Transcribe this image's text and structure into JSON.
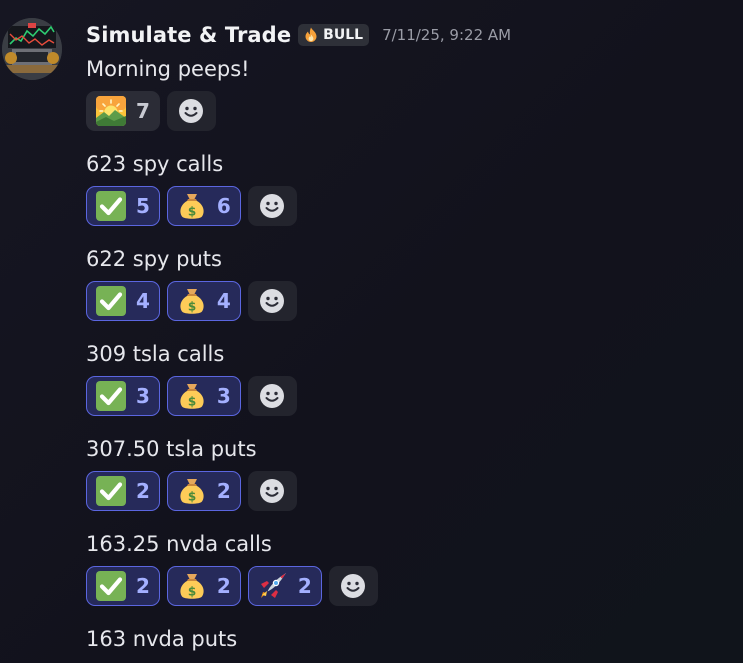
{
  "message": {
    "username": "Simulate & Trade",
    "tag": "BULL",
    "timestamp": "7/11/25, 9:22 AM",
    "lines": [
      {
        "text": "Morning peeps!",
        "reactions": [
          {
            "emoji": "sunrise-emoji",
            "count": "7",
            "active": false
          }
        ]
      },
      {
        "text": "623 spy calls",
        "reactions": [
          {
            "emoji": "check-mark-emoji",
            "count": "5",
            "active": true
          },
          {
            "emoji": "money-bag-emoji",
            "count": "6",
            "active": true
          }
        ]
      },
      {
        "text": "622 spy puts",
        "reactions": [
          {
            "emoji": "check-mark-emoji",
            "count": "4",
            "active": true
          },
          {
            "emoji": "money-bag-emoji",
            "count": "4",
            "active": true
          }
        ]
      },
      {
        "text": "309 tsla calls",
        "reactions": [
          {
            "emoji": "check-mark-emoji",
            "count": "3",
            "active": true
          },
          {
            "emoji": "money-bag-emoji",
            "count": "3",
            "active": true
          }
        ]
      },
      {
        "text": "307.50 tsla puts",
        "reactions": [
          {
            "emoji": "check-mark-emoji",
            "count": "2",
            "active": true
          },
          {
            "emoji": "money-bag-emoji",
            "count": "2",
            "active": true
          }
        ]
      },
      {
        "text": "163.25 nvda calls",
        "reactions": [
          {
            "emoji": "check-mark-emoji",
            "count": "2",
            "active": true
          },
          {
            "emoji": "money-bag-emoji",
            "count": "2",
            "active": true
          },
          {
            "emoji": "rocket-emoji",
            "count": "2",
            "active": true
          }
        ]
      },
      {
        "text": "163 nvda puts",
        "reactions": []
      }
    ]
  },
  "colors": {
    "background": "#14141e",
    "reaction_active_bg": "#262a5a",
    "reaction_active_border": "#5b66e0",
    "reaction_count_active": "#a4b0ff",
    "tag_bg": "#2e3038"
  },
  "icons": {
    "avatar": "trading-desk-avatar",
    "tag": "fire-icon",
    "add_reaction": "smiley-add-reaction-icon"
  }
}
